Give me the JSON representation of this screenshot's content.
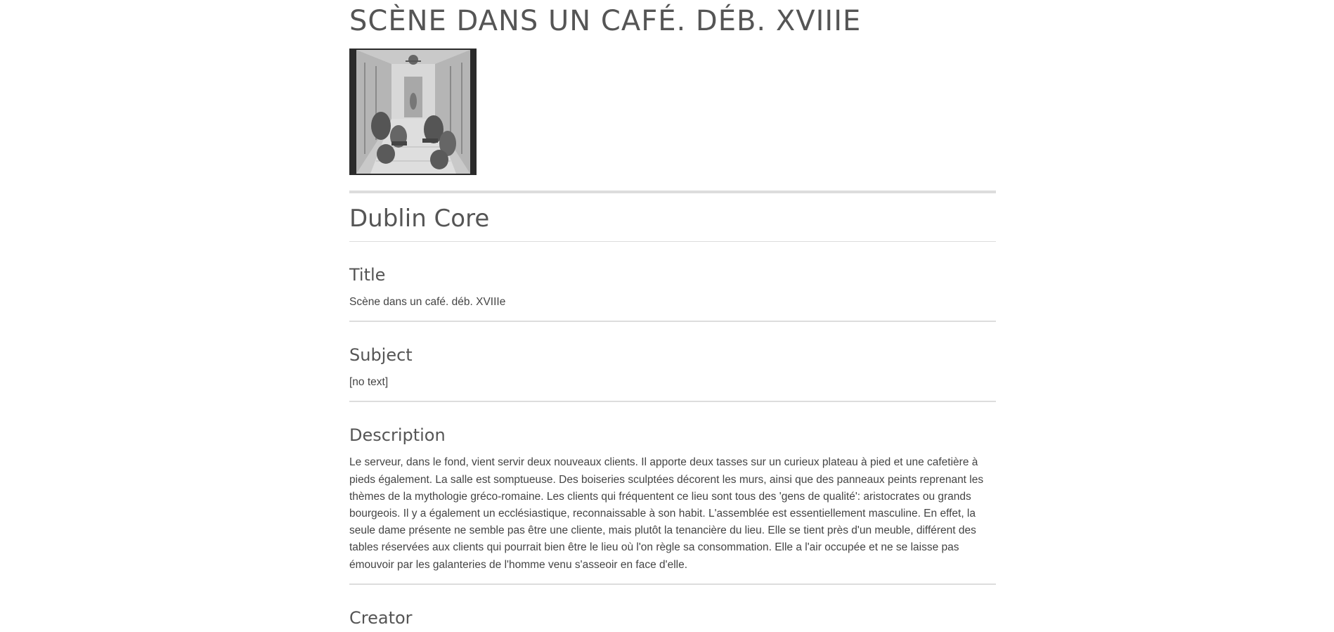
{
  "item": {
    "title": "SCÈNE DANS UN CAFÉ. DÉB. XVIIIE",
    "thumbnail_alt": "engraving-thumbnail"
  },
  "section": {
    "title": "Dublin Core"
  },
  "elements": {
    "title": {
      "label": "Title",
      "value": "Scène dans un café. déb. XVIIIe"
    },
    "subject": {
      "label": "Subject",
      "value": "[no text]"
    },
    "description": {
      "label": "Description",
      "value": "Le serveur, dans le fond, vient servir deux nouveaux clients. Il apporte deux tasses sur un curieux plateau à pied et une cafetière à pieds également. La salle est somptueuse. Des boiseries sculptées décorent les murs, ainsi que des panneaux peints reprenant les thèmes de la mythologie gréco-romaine. Les clients qui fréquentent ce lieu sont tous des 'gens de qualité': aristocrates ou grands bourgeois. Il y a également un ecclésiastique, reconnaissable à son habit. L'assemblée est essentiellement masculine. En effet, la seule dame présente ne semble pas être une cliente, mais plutôt la tenancière du lieu. Elle se tient près d'un meuble, différent des tables réservées aux clients qui pourrait bien être le lieu où l'on règle sa consommation. Elle a l'air occupée et ne se laisse pas émouvoir par les galanteries de l'homme venu s'asseoir en face d'elle."
    },
    "creator": {
      "label": "Creator"
    }
  }
}
